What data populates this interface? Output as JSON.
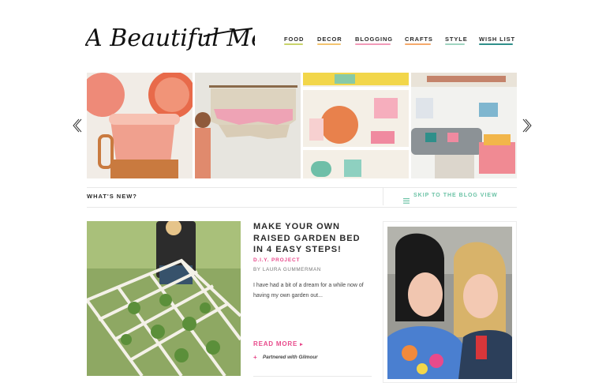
{
  "header": {
    "logo_text": "A Beautiful Mess",
    "nav": [
      {
        "label": "FOOD",
        "underline": "#c9d36a"
      },
      {
        "label": "DECOR",
        "underline": "#f3c46f"
      },
      {
        "label": "BLOGGING",
        "underline": "#f19ab8"
      },
      {
        "label": "CRAFTS",
        "underline": "#f5a96b"
      },
      {
        "label": "STYLE",
        "underline": "#9fd4c0"
      },
      {
        "label": "WISH LIST",
        "underline": "#2f8f8a"
      }
    ]
  },
  "slider": {
    "prev_icon": "chevron-left-icon",
    "next_icon": "chevron-right-icon"
  },
  "section_bar": {
    "title": "WHAT'S NEW?",
    "skip_label": "SKIP TO THE BLOG VIEW",
    "skip_icon": "menu-icon",
    "accent": "#6cc3a6"
  },
  "post": {
    "title": "MAKE YOUR OWN RAISED GARDEN BED IN 4 EASY STEPS!",
    "category": "D.I.Y. PROJECT",
    "author": "BY LAURA GUMMERMAN",
    "excerpt": "I have had a bit of a dream for a while now of having my own garden out...",
    "read_more": "READ MORE",
    "partner_plus": "+",
    "partner": "Partnered with Gilmour",
    "accent": "#e84a8b"
  }
}
